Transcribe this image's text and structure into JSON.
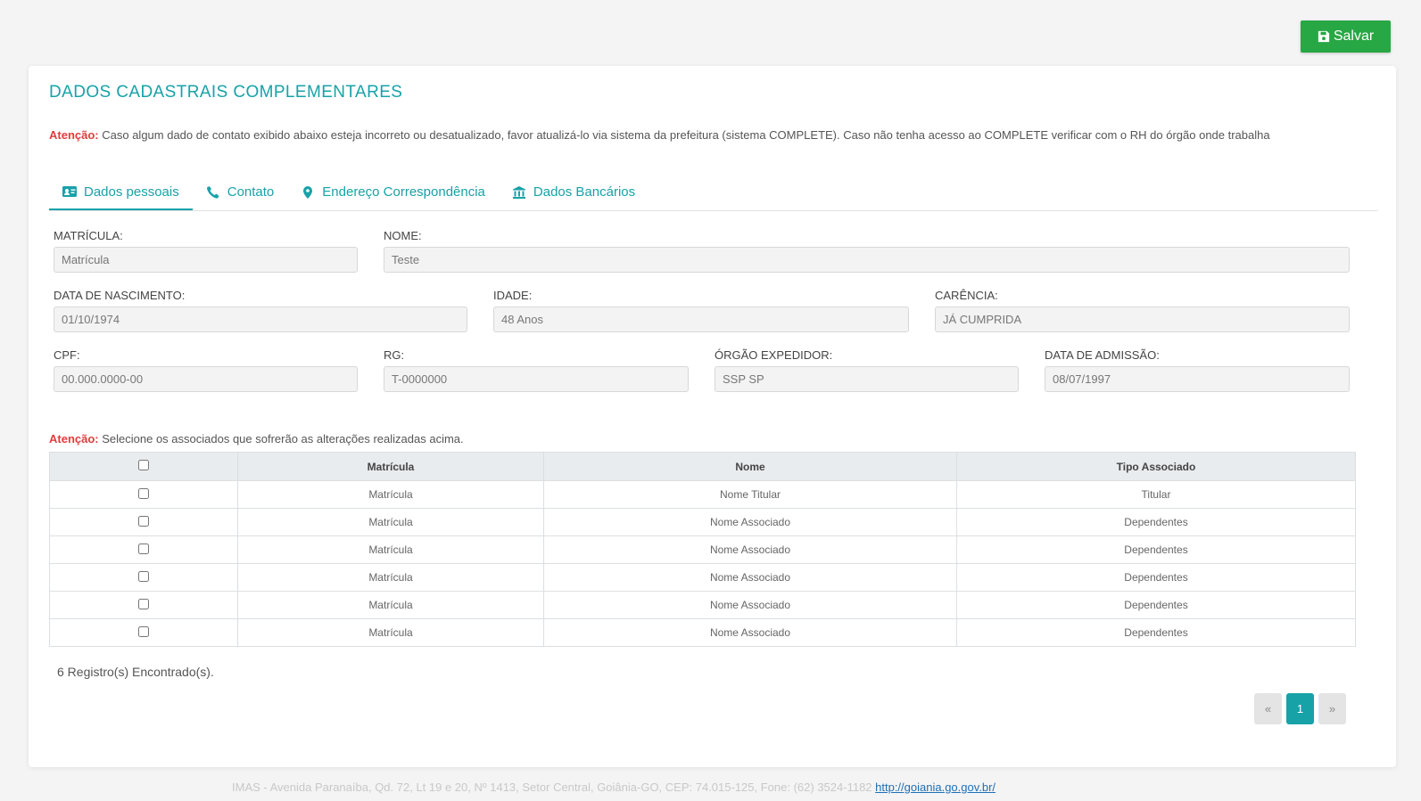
{
  "toolbar": {
    "save_label": "Salvar"
  },
  "page": {
    "title": "DADOS CADASTRAIS COMPLEMENTARES",
    "notice_label": "Atenção:",
    "notice_text": " Caso algum dado de contato exibido abaixo esteja incorreto ou desatualizado, favor atualizá-lo via sistema da prefeitura (sistema COMPLETE). Caso não tenha acesso ao COMPLETE verificar com o RH do órgão onde trabalha"
  },
  "tabs": [
    {
      "label": "Dados pessoais",
      "icon": "id-card-icon",
      "active": true
    },
    {
      "label": "Contato",
      "icon": "phone-icon"
    },
    {
      "label": "Endereço Correspondência",
      "icon": "map-marker-icon"
    },
    {
      "label": "Dados Bancários",
      "icon": "bank-icon"
    }
  ],
  "fields": {
    "matricula": {
      "label": "MATRÍCULA:",
      "placeholder": "Matrícula"
    },
    "nome": {
      "label": "NOME:",
      "value": "Teste"
    },
    "data_nascimento": {
      "label": "DATA DE NASCIMENTO:",
      "value": "01/10/1974"
    },
    "idade": {
      "label": "IDADE:",
      "value": "48 Anos"
    },
    "carencia": {
      "label": "CARÊNCIA:",
      "value": "JÁ CUMPRIDA"
    },
    "cpf": {
      "label": "CPF:",
      "value": "00.000.0000-00"
    },
    "rg": {
      "label": "RG:",
      "value": "T-0000000"
    },
    "orgao_expedidor": {
      "label": "ÓRGÃO EXPEDIDOR:",
      "value": "SSP SP"
    },
    "data_admissao": {
      "label": "DATA DE ADMISSÃO:",
      "value": "08/07/1997"
    }
  },
  "associates": {
    "notice_label": "Atenção:",
    "notice_text": " Selecione os associados que sofrerão as alterações realizadas acima.",
    "columns": [
      "Matrícula",
      "Nome",
      "Tipo Associado"
    ],
    "rows": [
      {
        "matricula": "Matrícula",
        "nome": "Nome Titular",
        "tipo": "Titular"
      },
      {
        "matricula": "Matrícula",
        "nome": "Nome Associado",
        "tipo": "Dependentes"
      },
      {
        "matricula": "Matrícula",
        "nome": "Nome Associado",
        "tipo": "Dependentes"
      },
      {
        "matricula": "Matrícula",
        "nome": "Nome Associado",
        "tipo": "Dependentes"
      },
      {
        "matricula": "Matrícula",
        "nome": "Nome Associado",
        "tipo": "Dependentes"
      },
      {
        "matricula": "Matrícula",
        "nome": "Nome Associado",
        "tipo": "Dependentes"
      }
    ],
    "records_text": "6 Registro(s) Encontrado(s)."
  },
  "pagination": {
    "prev": "«",
    "current": "1",
    "next": "»"
  },
  "footer": {
    "text": "IMAS - Avenida Paranaíba, Qd. 72, Lt 19 e 20, Nº 1413, Setor Central, Goiânia-GO, CEP: 74.015-125, Fone: (62) 3524-1182 ",
    "link": "http://goiania.go.gov.br/"
  },
  "colors": {
    "accent": "#17a2a8",
    "save": "#28a745",
    "warning": "#e23b3b"
  }
}
